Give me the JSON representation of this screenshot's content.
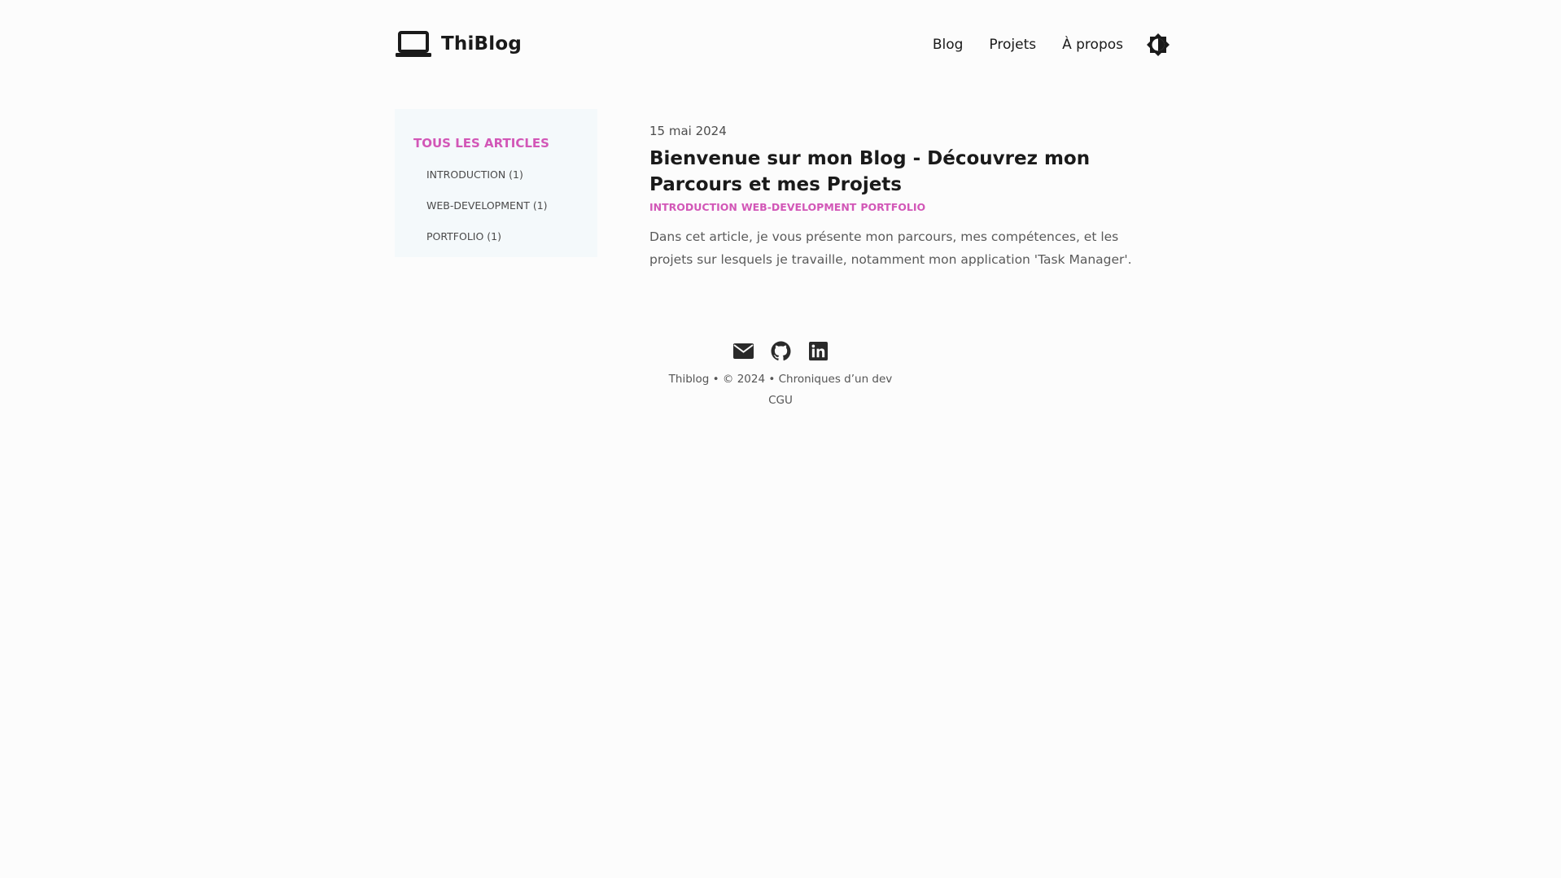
{
  "header": {
    "site_name": "ThiBlog",
    "nav": [
      {
        "label": "Blog"
      },
      {
        "label": "Projets"
      },
      {
        "label": "À propos"
      }
    ],
    "theme_toggle_icon": "contrast-icon"
  },
  "sidebar": {
    "title": "TOUS LES ARTICLES",
    "tags": [
      {
        "label": "INTRODUCTION (1)"
      },
      {
        "label": "WEB-DEVELOPMENT (1)"
      },
      {
        "label": "PORTFOLIO (1)"
      }
    ]
  },
  "post": {
    "date": "15 mai 2024",
    "title": "Bienvenue sur mon Blog - Découvrez mon Parcours et mes Projets",
    "tags": [
      "INTRODUCTION",
      "WEB-DEVELOPMENT",
      "PORTFOLIO"
    ],
    "summary": "Dans cet article, je vous présente mon parcours, mes compétences, et les projets sur lesquels je travaille, notamment mon application 'Task Manager'."
  },
  "footer": {
    "socials": [
      {
        "icon": "envelope-icon"
      },
      {
        "icon": "github-icon"
      },
      {
        "icon": "linkedin-icon"
      }
    ],
    "copyright": "Thiblog • © 2024 • Chroniques d’un dev",
    "cgu": "CGU"
  },
  "colors": {
    "accent": "#d257b7",
    "sidebar_bg": "#f4f9fb",
    "page_bg": "#fcfcfc"
  }
}
